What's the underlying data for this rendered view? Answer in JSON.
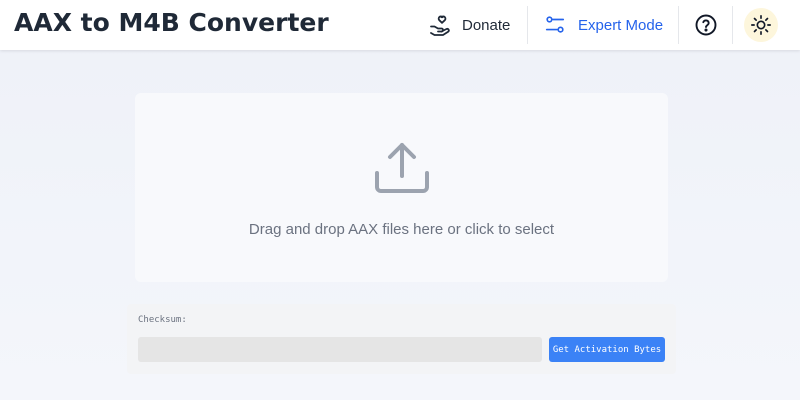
{
  "app": {
    "title": "AAX to M4B Converter"
  },
  "nav": {
    "donate": {
      "label": "Donate",
      "icon": "hand-heart-icon"
    },
    "expert_mode": {
      "label": "Expert Mode",
      "icon": "sliders-icon",
      "color": "#2563eb"
    },
    "help": {
      "icon": "help-circle-icon"
    },
    "theme": {
      "icon": "sun-icon",
      "background": "#fdf6dc"
    }
  },
  "dropzone": {
    "icon": "upload-icon",
    "text": "Drag and drop AAX files here or click to select"
  },
  "checksum": {
    "label": "Checksum:",
    "value": "",
    "button_label": "Get Activation Bytes",
    "button_color": "#3b82f6"
  }
}
